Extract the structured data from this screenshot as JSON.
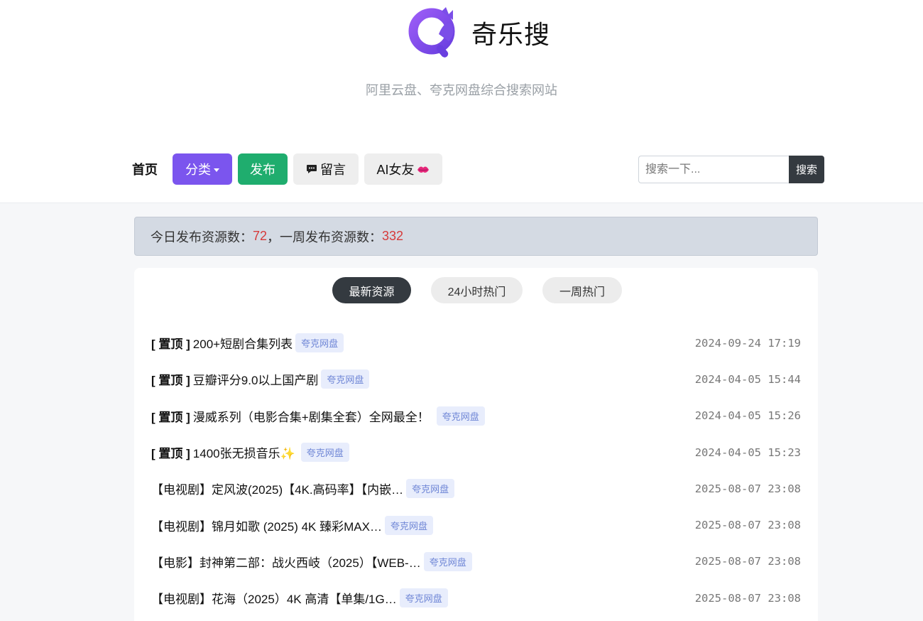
{
  "brand": {
    "name": "奇乐搜",
    "tagline": "阿里云盘、夸克网盘综合搜索网站",
    "logo_icon": "cat-magnifier-logo",
    "accent": "#7b55ee"
  },
  "nav": {
    "home": "首页",
    "category": "分类",
    "publish": "发布",
    "message": "留言",
    "ai_girlfriend": "AI女友"
  },
  "search": {
    "placeholder": "搜索一下...",
    "button": "搜索"
  },
  "stats": {
    "today_label": "今日发布资源数：",
    "today_value": "72",
    "sep": "，",
    "week_label": "一周发布资源数：",
    "week_value": "332"
  },
  "tabs": [
    {
      "label": "最新资源",
      "active": true
    },
    {
      "label": "24小时热门",
      "active": false
    },
    {
      "label": "一周热门",
      "active": false
    }
  ],
  "resources": [
    {
      "pin": "[ 置顶 ]",
      "title": "200+短剧合集列表",
      "source": "夸克网盘",
      "time": "2024-09-24 17:19"
    },
    {
      "pin": "[ 置顶 ]",
      "title": "豆瓣评分9.0以上国产剧",
      "source": "夸克网盘",
      "time": "2024-04-05 15:44"
    },
    {
      "pin": "[ 置顶 ]",
      "title": "漫威系列（电影合集+剧集全套）全网最全！",
      "source": "夸克网盘",
      "time": "2024-04-05 15:26"
    },
    {
      "pin": "[ 置顶 ]",
      "title": "1400张无损音乐✨",
      "source": "夸克网盘",
      "time": "2024-04-05 15:23"
    },
    {
      "pin": "",
      "title": "【电视剧】定风波(2025)【4K.高码率】【内嵌…",
      "source": "夸克网盘",
      "time": "2025-08-07 23:08"
    },
    {
      "pin": "",
      "title": "【电视剧】锦月如歌 (2025) 4K 臻彩MAX…",
      "source": "夸克网盘",
      "time": "2025-08-07 23:08"
    },
    {
      "pin": "",
      "title": "【电影】封神第二部：战火西岐（2025）【WEB-…",
      "source": "夸克网盘",
      "time": "2025-08-07 23:08"
    },
    {
      "pin": "",
      "title": "【电视剧】花海（2025）4K 高清【单集/1G…",
      "source": "夸克网盘",
      "time": "2025-08-07 23:08"
    }
  ]
}
